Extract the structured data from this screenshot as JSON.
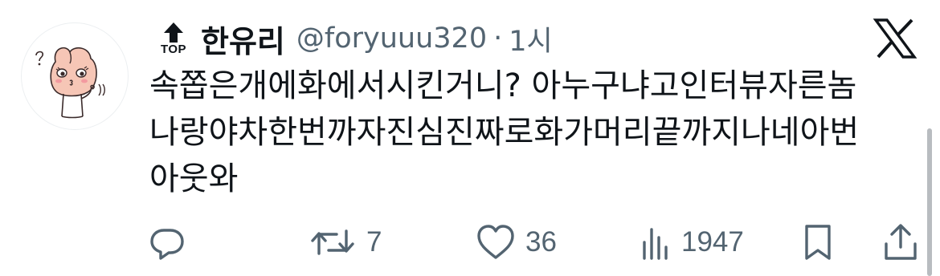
{
  "tweet": {
    "badge_label": "TOP",
    "display_name": "한유리",
    "handle": "@foryuuu320",
    "separator": "·",
    "time": "1시",
    "lines": [
      "속쫍은개에화에서시킨거니? 아누구냐고인터뷰자른놈",
      "나랑야차한번까자진심진짜로화가머리끝까지나네아번",
      "아웃와"
    ]
  },
  "actions": {
    "retweet_count": "7",
    "like_count": "36",
    "view_count": "1947"
  },
  "icons": {
    "badge": "top-arrow-icon",
    "brand": "x-logo-icon",
    "reply": "reply-icon",
    "retweet": "retweet-icon",
    "like": "heart-icon",
    "views": "views-icon",
    "bookmark": "bookmark-icon",
    "share": "share-icon"
  },
  "colors": {
    "text": "#0f1419",
    "muted": "#536471",
    "avatar_skin": "#f6c6b6"
  }
}
